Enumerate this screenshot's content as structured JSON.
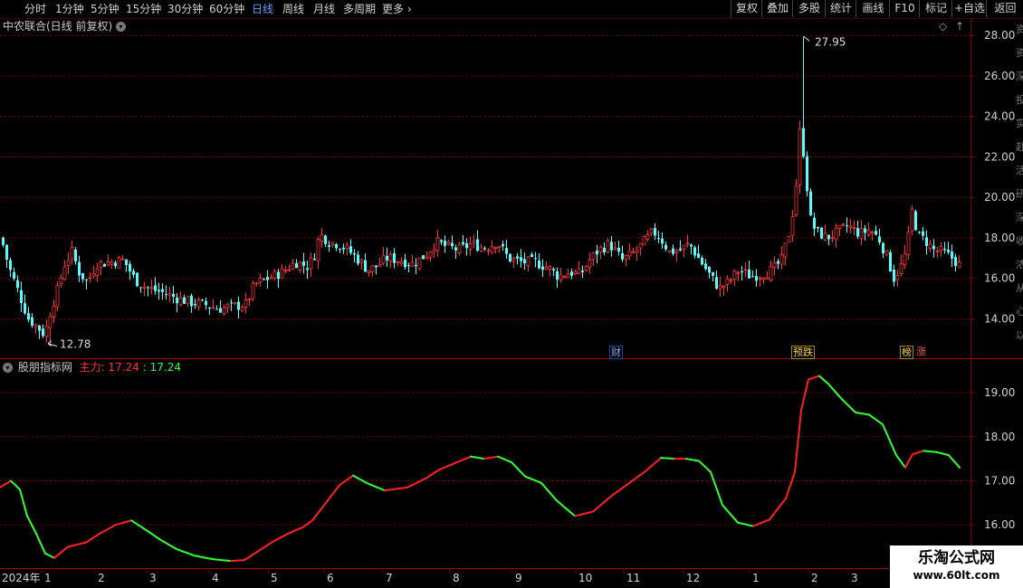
{
  "toolbar": {
    "periods": [
      "分时",
      "1分钟",
      "5分钟",
      "15分钟",
      "30分钟",
      "60分钟",
      "日线",
      "周线",
      "月线",
      "多周期",
      "更多"
    ],
    "active_period": "日线",
    "right_buttons": [
      "复权",
      "叠加",
      "多股",
      "统计",
      "画线",
      "F10",
      "标记",
      "+自选",
      "返回"
    ]
  },
  "main_panel": {
    "title": "中农联合(日线 前复权)",
    "y_ticks": [
      "28.00",
      "26.00",
      "24.00",
      "22.00",
      "20.00",
      "18.00",
      "16.00",
      "14.00"
    ],
    "max_label": "27.95",
    "min_label": "12.78",
    "markers": [
      "财",
      "预跌",
      "榜",
      "涨"
    ],
    "right_strip_text": "资资深投实赴活研深收浓从心以"
  },
  "indicator_panel": {
    "title": "股朋指标网",
    "series_label": "主力:",
    "value_red": "17.24",
    "value_green": "17.24",
    "y_ticks": [
      "19.00",
      "18.00",
      "17.00",
      "16.00"
    ]
  },
  "time_axis": {
    "year": "2024年",
    "months": [
      "1",
      "2",
      "3",
      "4",
      "5",
      "6",
      "7",
      "8",
      "9",
      "10",
      "11",
      "12",
      "1",
      "2",
      "3"
    ]
  },
  "watermark": {
    "line1": "乐淘公式网",
    "line2": "www.60lt.com"
  },
  "colors": {
    "up": "#ff3232",
    "down": "#54ffff",
    "line_up": "#ff2020",
    "line_down": "#30ff30",
    "grid": "#800000",
    "axis_text": "#d0d0d0"
  },
  "chart_data": [
    {
      "type": "candlestick",
      "title": "中农联合(日线 前复权)",
      "ylim": [
        12.5,
        28.5
      ],
      "x_axis": [
        "2024年",
        "1",
        "2",
        "3",
        "4",
        "5",
        "6",
        "7",
        "8",
        "9",
        "10",
        "11",
        "12",
        "1",
        "2",
        "3"
      ],
      "close_trajectory": [
        [
          0,
          18.0
        ],
        [
          8,
          16.6
        ],
        [
          20,
          15.2
        ],
        [
          30,
          14.0
        ],
        [
          40,
          13.6
        ],
        [
          48,
          13.2
        ],
        [
          55,
          14.5
        ],
        [
          62,
          15.4
        ],
        [
          70,
          16.7
        ],
        [
          78,
          17.3
        ],
        [
          86,
          16.3
        ],
        [
          95,
          15.8
        ],
        [
          105,
          16.7
        ],
        [
          120,
          16.8
        ],
        [
          135,
          16.9
        ],
        [
          148,
          15.9
        ],
        [
          162,
          15.5
        ],
        [
          178,
          15.3
        ],
        [
          195,
          15.0
        ],
        [
          210,
          14.8
        ],
        [
          225,
          14.7
        ],
        [
          240,
          14.5
        ],
        [
          255,
          14.6
        ],
        [
          270,
          14.7
        ],
        [
          280,
          15.7
        ],
        [
          295,
          16.0
        ],
        [
          310,
          16.3
        ],
        [
          325,
          16.8
        ],
        [
          338,
          16.6
        ],
        [
          345,
          17.0
        ],
        [
          352,
          18.2
        ],
        [
          362,
          17.8
        ],
        [
          372,
          17.7
        ],
        [
          383,
          17.4
        ],
        [
          395,
          16.9
        ],
        [
          405,
          16.4
        ],
        [
          415,
          16.6
        ],
        [
          425,
          17.0
        ],
        [
          440,
          16.9
        ],
        [
          455,
          16.7
        ],
        [
          470,
          17.2
        ],
        [
          480,
          17.8
        ],
        [
          490,
          17.6
        ],
        [
          505,
          17.4
        ],
        [
          520,
          17.7
        ],
        [
          535,
          17.5
        ],
        [
          548,
          17.8
        ],
        [
          560,
          17.0
        ],
        [
          575,
          16.8
        ],
        [
          590,
          16.8
        ],
        [
          605,
          16.5
        ],
        [
          615,
          16.1
        ],
        [
          628,
          16.3
        ],
        [
          640,
          16.2
        ],
        [
          650,
          16.9
        ],
        [
          660,
          17.4
        ],
        [
          672,
          17.7
        ],
        [
          686,
          16.9
        ],
        [
          700,
          17.3
        ],
        [
          712,
          17.9
        ],
        [
          720,
          18.3
        ],
        [
          728,
          18.0
        ],
        [
          738,
          17.3
        ],
        [
          750,
          17.4
        ],
        [
          760,
          17.7
        ],
        [
          770,
          17.0
        ],
        [
          782,
          16.2
        ],
        [
          793,
          15.5
        ],
        [
          803,
          15.8
        ],
        [
          815,
          16.4
        ],
        [
          828,
          16.1
        ],
        [
          840,
          16.2
        ],
        [
          852,
          16.4
        ],
        [
          862,
          16.9
        ],
        [
          870,
          18.2
        ],
        [
          877,
          20.0
        ],
        [
          882,
          23.2
        ],
        [
          887,
          22.0
        ],
        [
          893,
          19.0
        ],
        [
          900,
          18.3
        ],
        [
          912,
          18.0
        ],
        [
          925,
          18.3
        ],
        [
          935,
          18.6
        ],
        [
          948,
          18.2
        ],
        [
          960,
          18.4
        ],
        [
          970,
          17.9
        ],
        [
          978,
          17.1
        ],
        [
          986,
          16.0
        ],
        [
          995,
          16.7
        ],
        [
          1000,
          17.4
        ],
        [
          1006,
          19.3
        ],
        [
          1013,
          18.1
        ],
        [
          1020,
          17.9
        ],
        [
          1030,
          17.4
        ],
        [
          1040,
          17.3
        ],
        [
          1050,
          17.0
        ],
        [
          1060,
          16.6
        ]
      ],
      "max_price": 27.95,
      "min_price": 12.78
    },
    {
      "type": "line",
      "series": [
        {
          "name": "主力"
        }
      ],
      "ylim": [
        15.1,
        19.7
      ],
      "last_value": 17.24,
      "points": [
        [
          0,
          16.85
        ],
        [
          12,
          17.0
        ],
        [
          22,
          16.8
        ],
        [
          30,
          16.2
        ],
        [
          40,
          15.8
        ],
        [
          50,
          15.35
        ],
        [
          60,
          15.25
        ],
        [
          75,
          15.5
        ],
        [
          95,
          15.6
        ],
        [
          110,
          15.8
        ],
        [
          128,
          16.0
        ],
        [
          145,
          16.1
        ],
        [
          160,
          15.9
        ],
        [
          178,
          15.65
        ],
        [
          195,
          15.45
        ],
        [
          215,
          15.3
        ],
        [
          235,
          15.22
        ],
        [
          255,
          15.18
        ],
        [
          270,
          15.2
        ],
        [
          285,
          15.4
        ],
        [
          300,
          15.6
        ],
        [
          318,
          15.8
        ],
        [
          335,
          15.95
        ],
        [
          345,
          16.1
        ],
        [
          360,
          16.5
        ],
        [
          375,
          16.9
        ],
        [
          390,
          17.12
        ],
        [
          405,
          16.95
        ],
        [
          425,
          16.78
        ],
        [
          450,
          16.85
        ],
        [
          470,
          17.05
        ],
        [
          485,
          17.25
        ],
        [
          500,
          17.38
        ],
        [
          520,
          17.55
        ],
        [
          535,
          17.5
        ],
        [
          550,
          17.55
        ],
        [
          565,
          17.42
        ],
        [
          580,
          17.1
        ],
        [
          598,
          16.95
        ],
        [
          615,
          16.55
        ],
        [
          635,
          16.2
        ],
        [
          655,
          16.3
        ],
        [
          675,
          16.65
        ],
        [
          695,
          16.95
        ],
        [
          712,
          17.2
        ],
        [
          730,
          17.52
        ],
        [
          745,
          17.5
        ],
        [
          758,
          17.5
        ],
        [
          772,
          17.45
        ],
        [
          785,
          17.2
        ],
        [
          798,
          16.45
        ],
        [
          815,
          16.05
        ],
        [
          832,
          15.97
        ],
        [
          850,
          16.12
        ],
        [
          868,
          16.6
        ],
        [
          878,
          17.2
        ],
        [
          885,
          18.6
        ],
        [
          893,
          19.3
        ],
        [
          905,
          19.38
        ],
        [
          915,
          19.2
        ],
        [
          930,
          18.85
        ],
        [
          945,
          18.55
        ],
        [
          960,
          18.5
        ],
        [
          975,
          18.28
        ],
        [
          990,
          17.58
        ],
        [
          1000,
          17.3
        ],
        [
          1008,
          17.6
        ],
        [
          1020,
          17.68
        ],
        [
          1035,
          17.65
        ],
        [
          1048,
          17.58
        ],
        [
          1060,
          17.3
        ]
      ]
    }
  ]
}
